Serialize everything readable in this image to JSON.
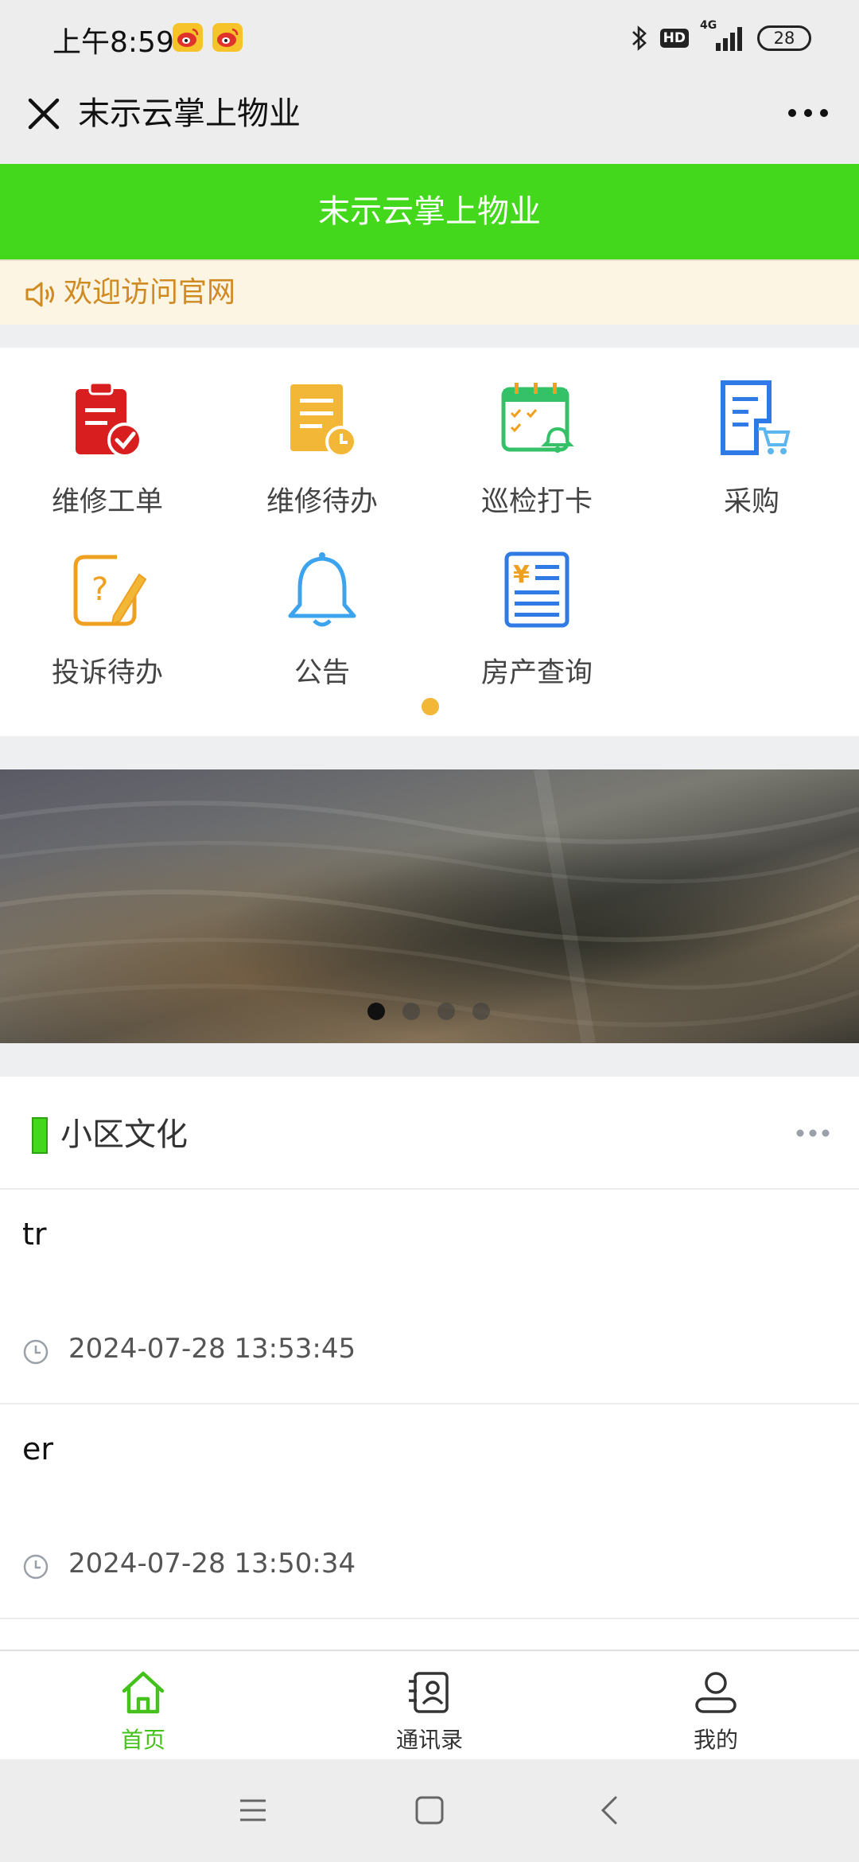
{
  "status_bar": {
    "time": "上午8:59",
    "hd": "HD",
    "network": "4G",
    "battery": "28"
  },
  "title_bar": {
    "title": "末示云掌上物业"
  },
  "header": {
    "title": "末示云掌上物业"
  },
  "notice": {
    "text": "欢迎访问官网"
  },
  "menu": {
    "items": [
      {
        "label": "维修工单",
        "icon": "clipboard-check-icon",
        "color": "#d81e1e"
      },
      {
        "label": "维修待办",
        "icon": "document-clock-icon",
        "color": "#f3b737"
      },
      {
        "label": "巡检打卡",
        "icon": "calendar-bell-icon",
        "color": "#35c167"
      },
      {
        "label": "采购",
        "icon": "document-cart-icon",
        "color": "#2f7ae5"
      },
      {
        "label": "投诉待办",
        "icon": "complaint-pen-icon",
        "color": "#f0a020"
      },
      {
        "label": "公告",
        "icon": "bell-icon",
        "color": "#3ca3ee"
      },
      {
        "label": "房产查询",
        "icon": "bill-yen-icon",
        "color": "#2f7ae5"
      }
    ]
  },
  "banner": {
    "slides": 4,
    "active_index": 0
  },
  "culture": {
    "title": "小区文化",
    "accent": "#44d81c",
    "items": [
      {
        "title": "tr",
        "time": "2024-07-28 13:53:45"
      },
      {
        "title": "er",
        "time": "2024-07-28 13:50:34"
      }
    ]
  },
  "tabbar": {
    "items": [
      {
        "label": "首页",
        "icon": "home-icon",
        "active": true
      },
      {
        "label": "通讯录",
        "icon": "contacts-icon",
        "active": false
      },
      {
        "label": "我的",
        "icon": "user-icon",
        "active": false
      }
    ],
    "active_color": "#44c11a"
  },
  "colors": {
    "brand_green": "#44d81c",
    "notice_text": "#d08a22",
    "notice_bg": "#fcf5e4"
  }
}
